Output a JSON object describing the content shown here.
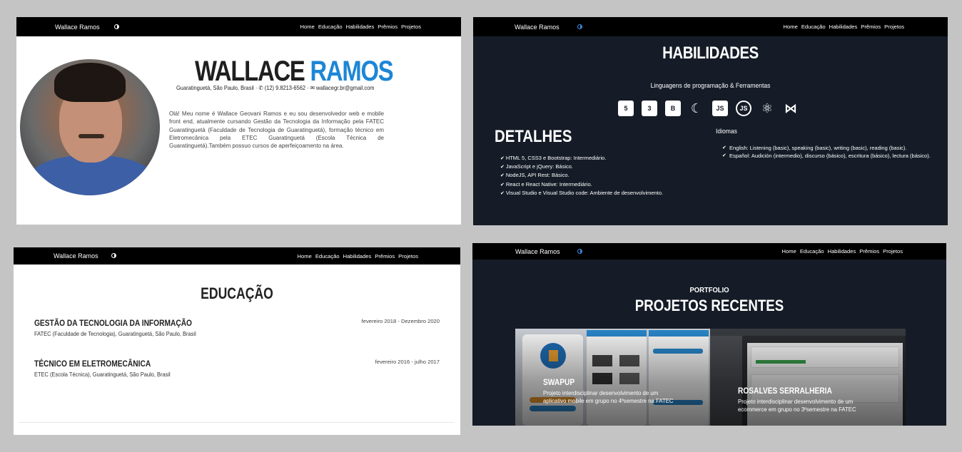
{
  "nav": {
    "brand": "Wallace Ramos",
    "links": [
      "Home",
      "Educação",
      "Habilidades",
      "Prêmios",
      "Projetos"
    ]
  },
  "hero": {
    "first_name": "WALLACE",
    "last_name": "RAMOS",
    "location": "Guaratinguetá, São Paulo, Brasil",
    "phone": "(12) 9.8213-6562",
    "email": "wallacegr.br@gmail.com",
    "bio": "Olá! Meu nome é Wallace Geovani Ramos e eu sou desenvolvedor web e mobile front end, atualmente cursando Gestão da Tecnologia da Informação pela FATEC Guaratinguetá (Faculdade de Tecnologia de Guaratinguetá), formação técnico em Eletromecânica pela ETEC Guaratinguetá (Escola Técnica de Guaratinguetá).Também possuo cursos de aperfeiçoamento na área."
  },
  "skills": {
    "title": "HABILIDADES",
    "subtitle": "Linguagens de programação & Ferramentas",
    "icons": [
      "html5-icon",
      "css3-icon",
      "bootstrap-icon",
      "jquery-icon",
      "javascript-icon",
      "nodejs-icon",
      "react-icon",
      "visual-studio-code-icon"
    ],
    "details_title": "DETALHES",
    "details": [
      "HTML 5, CSS3 e Bootstrap: Intermediário.",
      "JavaScript e jQuery: Básico.",
      "NodeJS, API Rest: Básico.",
      "React e React Native: Intermediário.",
      "Visual Studio e Visual Studio code: Ambiente de desenvolvimento."
    ],
    "languages_title": "Idiomas",
    "languages": [
      "English: Listening (basic), speaking (basic), writing (basic), reading (basic).",
      "Español: Audición (intermedio), discurso (básico), escritura (básico), lectura (básico)."
    ]
  },
  "education": {
    "title": "EDUCAÇÃO",
    "items": [
      {
        "degree": "GESTÃO DA TECNOLOGIA DA INFORMAÇÃO",
        "school": "FATEC (Faculdade de Tecnologia), Guaratinguetá, São Paulo, Brasil",
        "period": "fevereiro 2018 - Dezembro 2020"
      },
      {
        "degree": "TÉCNICO EM ELETROMECÂNICA",
        "school": "ETEC (Escola Técnica), Guaratinguetá, São Paulo, Brasil",
        "period": "fevereiro 2016 - julho 2017"
      }
    ]
  },
  "portfolio": {
    "kicker": "PORTFOLIO",
    "title": "PROJETOS RECENTES",
    "projects": [
      {
        "name": "SWAPUP",
        "description": "Projeto interdisciplinar desenvolvimento de um aplicativo mobile em grupo no 4ºsemestre na FATEC"
      },
      {
        "name": "ROSALVES SERRALHERIA",
        "description": "Projeto interdisciplinar desenvolvimento de um ecommerce em grupo no 3ºsemestre na FATEC"
      }
    ]
  },
  "colors": {
    "accent": "#1d86d6",
    "dark_bg": "#151c27",
    "nav_bg": "#000000",
    "page_bg": "#c4c4c4"
  }
}
